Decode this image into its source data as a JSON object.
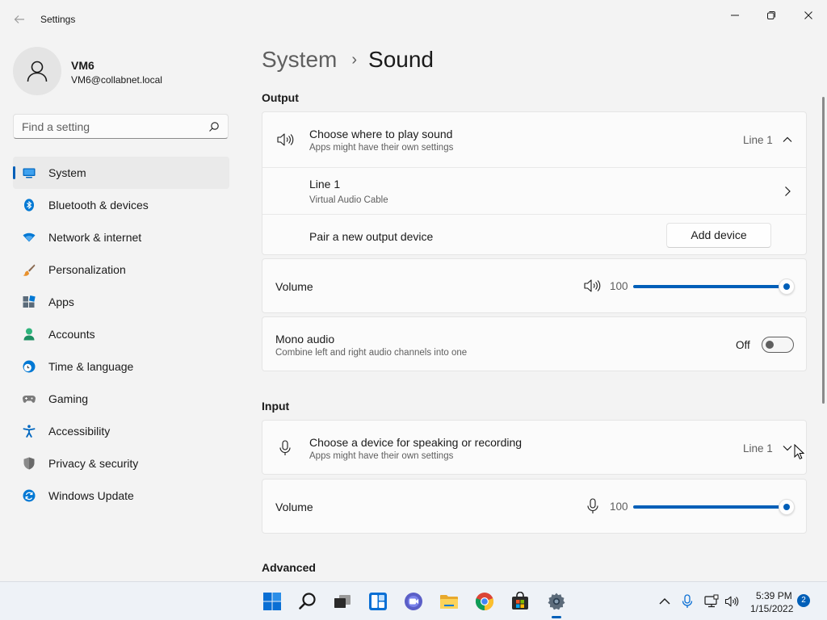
{
  "window": {
    "title": "Settings",
    "back_icon": "arrow-left-icon",
    "controls": [
      "minimize-icon",
      "restore-icon",
      "close-icon"
    ]
  },
  "profile": {
    "name": "VM6",
    "email": "VM6@collabnet.local"
  },
  "search": {
    "placeholder": "Find a setting",
    "icon": "search-icon"
  },
  "sidebar": {
    "items": [
      {
        "label": "System",
        "icon": "system-icon",
        "selected": true,
        "color": "#0067c0"
      },
      {
        "label": "Bluetooth & devices",
        "icon": "bluetooth-icon",
        "selected": false,
        "color": "#0078d4"
      },
      {
        "label": "Network & internet",
        "icon": "wifi-icon",
        "selected": false,
        "color": "#0078d4"
      },
      {
        "label": "Personalization",
        "icon": "brush-icon",
        "selected": false,
        "color": "#e8912d"
      },
      {
        "label": "Apps",
        "icon": "apps-icon",
        "selected": false,
        "color": "#5b6b7a"
      },
      {
        "label": "Accounts",
        "icon": "accounts-icon",
        "selected": false,
        "color": "#2fb47c"
      },
      {
        "label": "Time & language",
        "icon": "clock-globe-icon",
        "selected": false,
        "color": "#0078d4"
      },
      {
        "label": "Gaming",
        "icon": "gamepad-icon",
        "selected": false,
        "color": "#6e6e6e"
      },
      {
        "label": "Accessibility",
        "icon": "accessibility-icon",
        "selected": false,
        "color": "#0067c0"
      },
      {
        "label": "Privacy & security",
        "icon": "shield-icon",
        "selected": false,
        "color": "#7a7a7a"
      },
      {
        "label": "Windows Update",
        "icon": "update-icon",
        "selected": false,
        "color": "#0078d4"
      }
    ]
  },
  "breadcrumb": {
    "parent": "System",
    "separator": "›",
    "current": "Sound"
  },
  "output": {
    "section_title": "Output",
    "choose_title": "Choose where to play sound",
    "choose_sub": "Apps might have their own settings",
    "choose_value": "Line 1",
    "device_name": "Line 1",
    "device_desc": "Virtual Audio Cable",
    "pair_label": "Pair a new output device",
    "add_button": "Add device",
    "volume_label": "Volume",
    "volume_value": "100",
    "volume_level": 1.0,
    "mono_title": "Mono audio",
    "mono_sub": "Combine left and right audio channels into one",
    "mono_state": "Off"
  },
  "input": {
    "section_title": "Input",
    "choose_title": "Choose a device for speaking or recording",
    "choose_sub": "Apps might have their own settings",
    "choose_value": "Line 1",
    "volume_label": "Volume",
    "volume_value": "100",
    "volume_level": 1.0
  },
  "advanced": {
    "section_title": "Advanced"
  },
  "taskbar": {
    "apps": [
      "start-icon",
      "search-icon",
      "task-view-icon",
      "widgets-icon",
      "chat-icon",
      "file-explorer-icon",
      "chrome-icon",
      "store-icon",
      "settings-icon"
    ],
    "tray": [
      "chevron-up-icon",
      "microphone-icon",
      "network-icon",
      "speaker-icon"
    ],
    "time": "5:39 PM",
    "date": "1/15/2022",
    "notifications": "2"
  },
  "colors": {
    "accent": "#005fb8",
    "background": "#f3f3f3",
    "card": "#fbfbfb"
  }
}
